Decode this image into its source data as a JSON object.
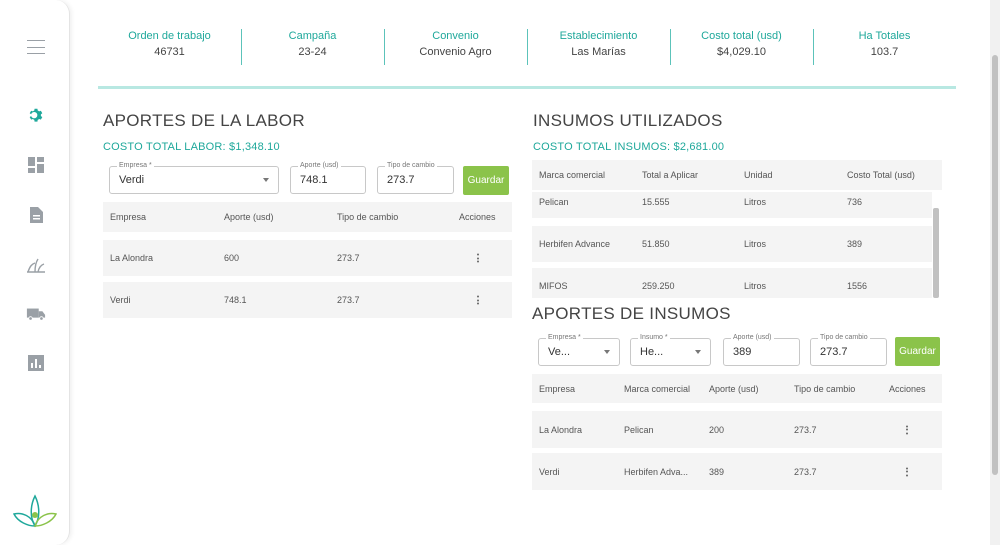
{
  "summary": [
    {
      "label": "Orden de trabajo",
      "value": "46731"
    },
    {
      "label": "Campaña",
      "value": "23-24"
    },
    {
      "label": "Convenio",
      "value": "Convenio Agro"
    },
    {
      "label": "Establecimiento",
      "value": "Las Marías"
    },
    {
      "label": "Costo total (usd)",
      "value": "$4,029.10"
    },
    {
      "label": "Ha Totales",
      "value": "103.7"
    }
  ],
  "labor": {
    "title": "APORTES DE LA LABOR",
    "subtitle": "COSTO TOTAL LABOR: $1,348.10",
    "empresa_label": "Empresa *",
    "empresa_value": "Verdi",
    "aporte_label": "Aporte (usd)",
    "aporte_value": "748.1",
    "tipo_label": "Tipo de cambio",
    "tipo_value": "273.7",
    "save_label": "Guardar",
    "columns": [
      "Empresa",
      "Aporte (usd)",
      "Tipo de cambio",
      "Acciones"
    ],
    "rows": [
      {
        "empresa": "La Alondra",
        "aporte": "600",
        "tipo": "273.7"
      },
      {
        "empresa": "Verdi",
        "aporte": "748.1",
        "tipo": "273.7"
      }
    ]
  },
  "insumos_utilizados": {
    "title": "INSUMOS UTILIZADOS",
    "subtitle": "COSTO TOTAL INSUMOS: $2,681.00",
    "columns": [
      "Marca comercial",
      "Total a Aplicar",
      "Unidad",
      "Costo Total (usd)"
    ],
    "rows": [
      {
        "marca": "Pelican",
        "total": "15.555",
        "unidad": "Litros",
        "costo": "736"
      },
      {
        "marca": "Herbifen Advance",
        "total": "51.850",
        "unidad": "Litros",
        "costo": "389"
      },
      {
        "marca": "MIFOS",
        "total": "259.250",
        "unidad": "Litros",
        "costo": "1556"
      }
    ]
  },
  "aportes_insumos": {
    "title": "APORTES DE INSUMOS",
    "empresa_label": "Empresa *",
    "empresa_value": "Ve...",
    "insumo_label": "Insumo *",
    "insumo_value": "He...",
    "aporte_label": "Aporte (usd)",
    "aporte_value": "389",
    "tipo_label": "Tipo de cambio",
    "tipo_value": "273.7",
    "save_label": "Guardar",
    "columns": [
      "Empresa",
      "Marca comercial",
      "Aporte (usd)",
      "Tipo de cambio",
      "Acciones"
    ],
    "rows": [
      {
        "empresa": "La Alondra",
        "marca": "Pelican",
        "aporte": "200",
        "tipo": "273.7"
      },
      {
        "empresa": "Verdi",
        "marca": "Herbifen Adva...",
        "aporte": "389",
        "tipo": "273.7"
      }
    ]
  },
  "sidebar": {
    "icons": [
      "menu-icon",
      "settings-icon",
      "dashboard-icon",
      "document-icon",
      "crop-icon",
      "truck-icon",
      "chart-icon"
    ],
    "active_color": "#1fa89b",
    "icon_color": "#9aa0a6"
  },
  "colors": {
    "accent": "#1fa89b",
    "button": "#8bc34a"
  }
}
